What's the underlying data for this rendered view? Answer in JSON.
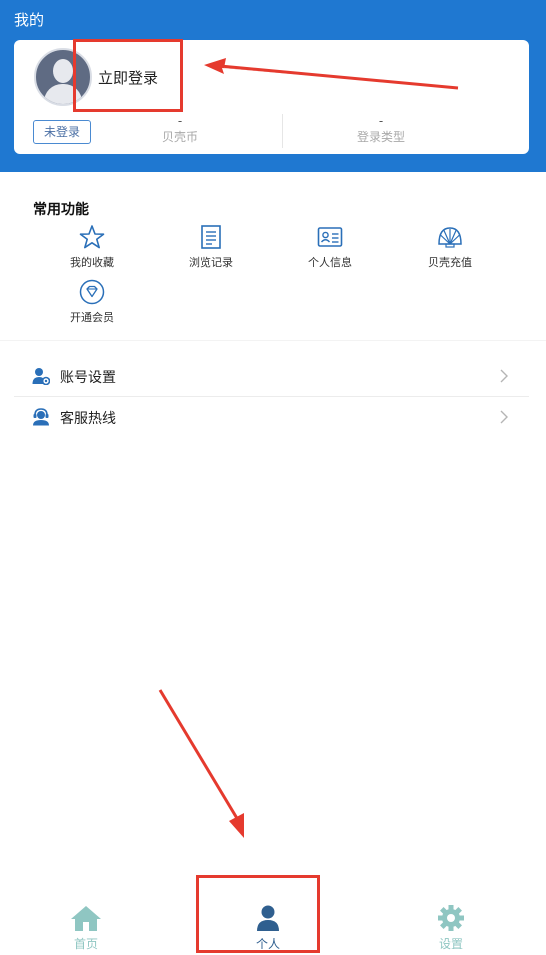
{
  "header": {
    "title": "我的"
  },
  "profile": {
    "login_link": "立即登录",
    "status_badge": "未登录",
    "coins_value": "-",
    "coins_label": "贝壳币",
    "login_type_value": "-",
    "login_type_label": "登录类型"
  },
  "functions": {
    "title": "常用功能",
    "items": [
      {
        "label": "我的收藏",
        "icon": "star-icon"
      },
      {
        "label": "浏览记录",
        "icon": "history-list-icon"
      },
      {
        "label": "个人信息",
        "icon": "id-card-icon"
      },
      {
        "label": "贝壳充值",
        "icon": "shell-icon"
      },
      {
        "label": "开通会员",
        "icon": "diamond-icon"
      }
    ]
  },
  "menu": [
    {
      "label": "账号设置",
      "icon": "user-settings-icon"
    },
    {
      "label": "客服热线",
      "icon": "customer-service-icon"
    }
  ],
  "tabbar": {
    "tabs": [
      {
        "label": "首页",
        "icon": "home-icon",
        "active": false
      },
      {
        "label": "个人",
        "icon": "person-icon",
        "active": true
      },
      {
        "label": "设置",
        "icon": "gear-icon",
        "active": false
      }
    ]
  },
  "colors": {
    "header_bg": "#1f78d1",
    "accent_blue": "#2a6fb8",
    "tab_inactive": "#8fc6c2",
    "tab_active": "#2f5f8f",
    "annotation_red": "#e53a2e"
  }
}
